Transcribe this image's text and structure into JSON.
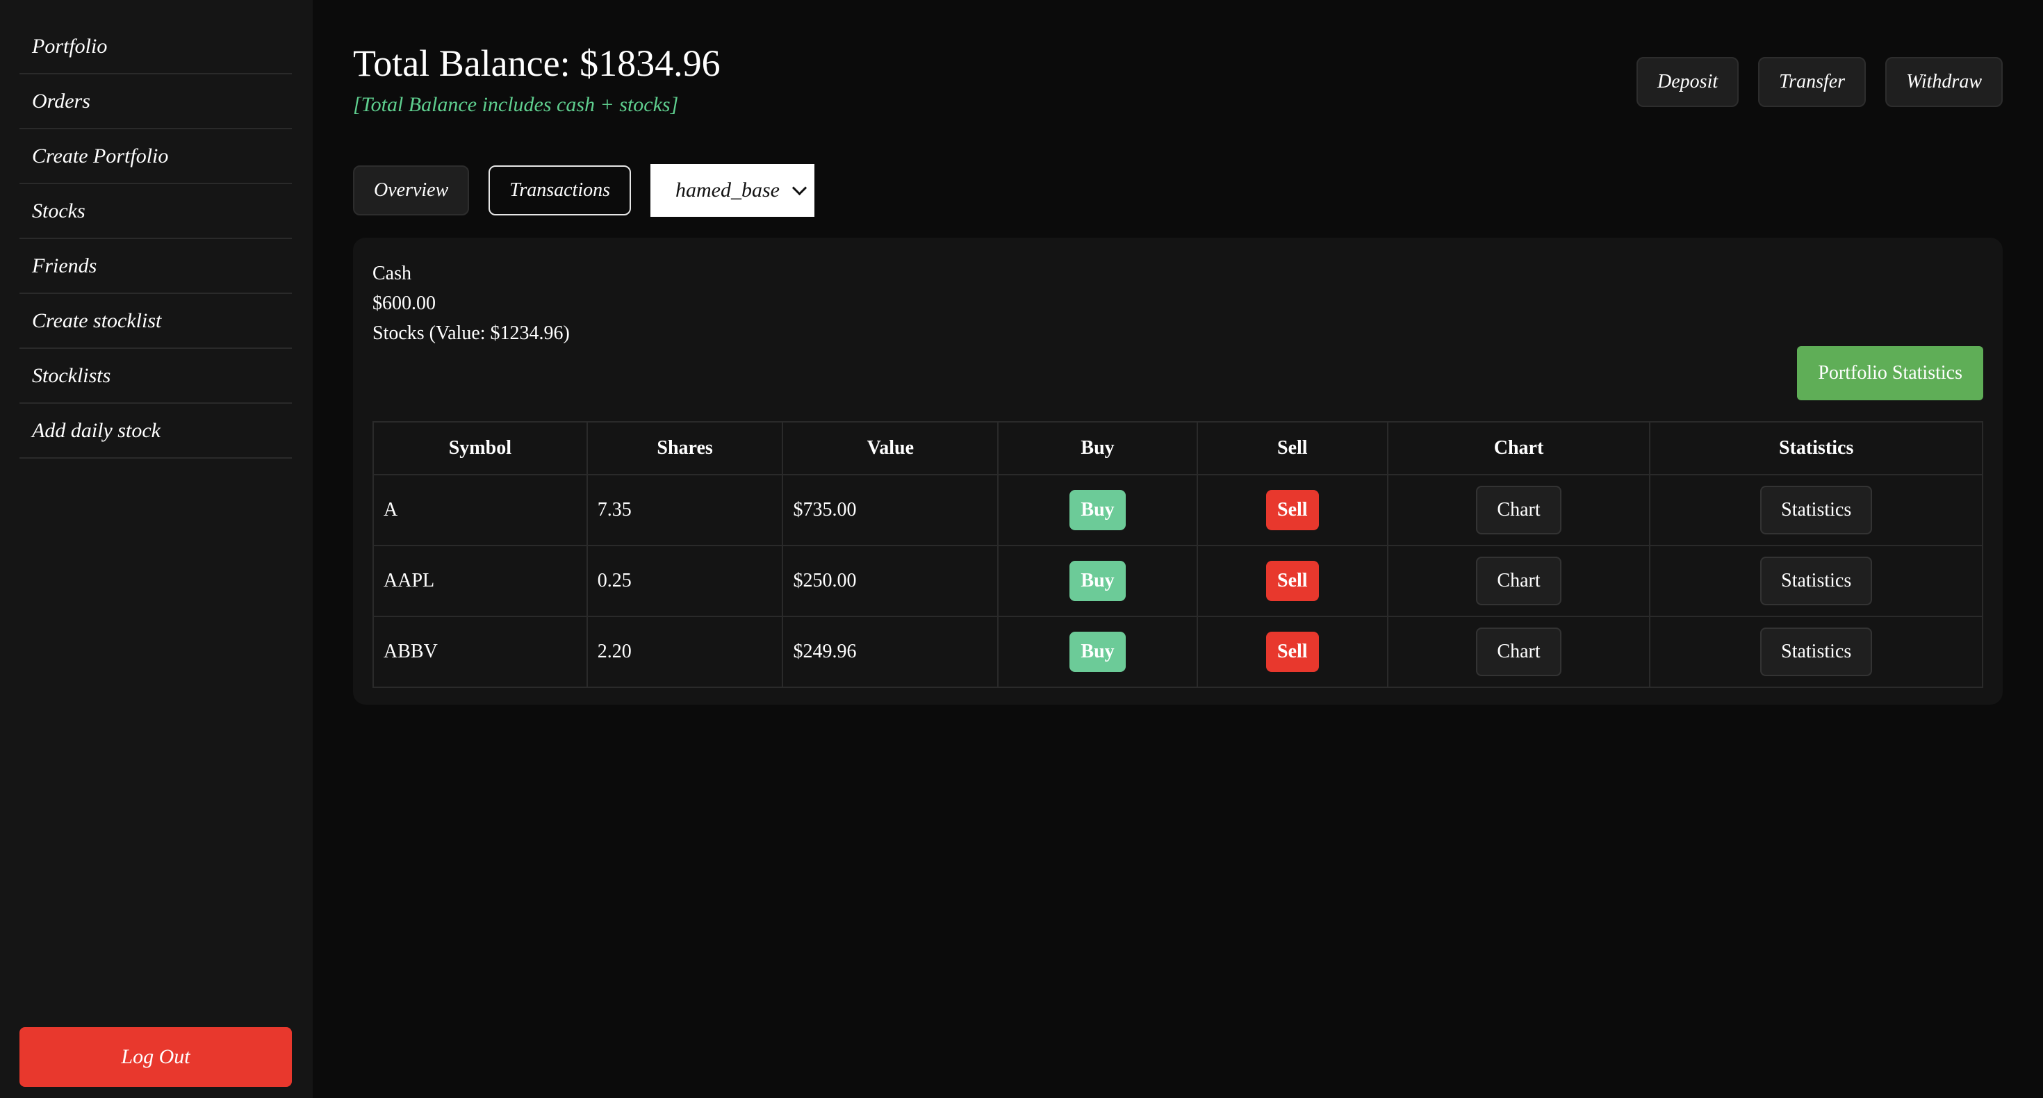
{
  "sidebar": {
    "items": [
      {
        "label": "Portfolio"
      },
      {
        "label": "Orders"
      },
      {
        "label": "Create Portfolio"
      },
      {
        "label": "Stocks"
      },
      {
        "label": "Friends"
      },
      {
        "label": "Create stocklist"
      },
      {
        "label": "Stocklists"
      },
      {
        "label": "Add daily stock"
      }
    ],
    "logout_label": "Log Out"
  },
  "header": {
    "title": "Total Balance: $1834.96",
    "subtitle": "[Total Balance includes cash + stocks]",
    "actions": {
      "deposit": "Deposit",
      "transfer": "Transfer",
      "withdraw": "Withdraw"
    }
  },
  "tabs": {
    "overview": "Overview",
    "transactions": "Transactions",
    "portfolio_select": {
      "selected": "hamed_base"
    }
  },
  "summary": {
    "cash_label": "Cash",
    "cash_value": "$600.00",
    "stocks_label": "Stocks (Value: $1234.96)",
    "portfolio_stats_label": "Portfolio Statistics"
  },
  "table": {
    "headers": [
      "Symbol",
      "Shares",
      "Value",
      "Buy",
      "Sell",
      "Chart",
      "Statistics"
    ],
    "rows": [
      {
        "symbol": "A",
        "shares": "7.35",
        "value": "$735.00",
        "buy": "Buy",
        "sell": "Sell",
        "chart": "Chart",
        "statistics": "Statistics"
      },
      {
        "symbol": "AAPL",
        "shares": "0.25",
        "value": "$250.00",
        "buy": "Buy",
        "sell": "Sell",
        "chart": "Chart",
        "statistics": "Statistics"
      },
      {
        "symbol": "ABBV",
        "shares": "2.20",
        "value": "$249.96",
        "buy": "Buy",
        "sell": "Sell",
        "chart": "Chart",
        "statistics": "Statistics"
      }
    ]
  },
  "colors": {
    "background": "#0b0b0b",
    "sidebar": "#151515",
    "accent_green": "#5fae57",
    "buy_green": "#6ccb98",
    "danger_red": "#e8382d",
    "subtitle_green": "#5fcf8f"
  }
}
